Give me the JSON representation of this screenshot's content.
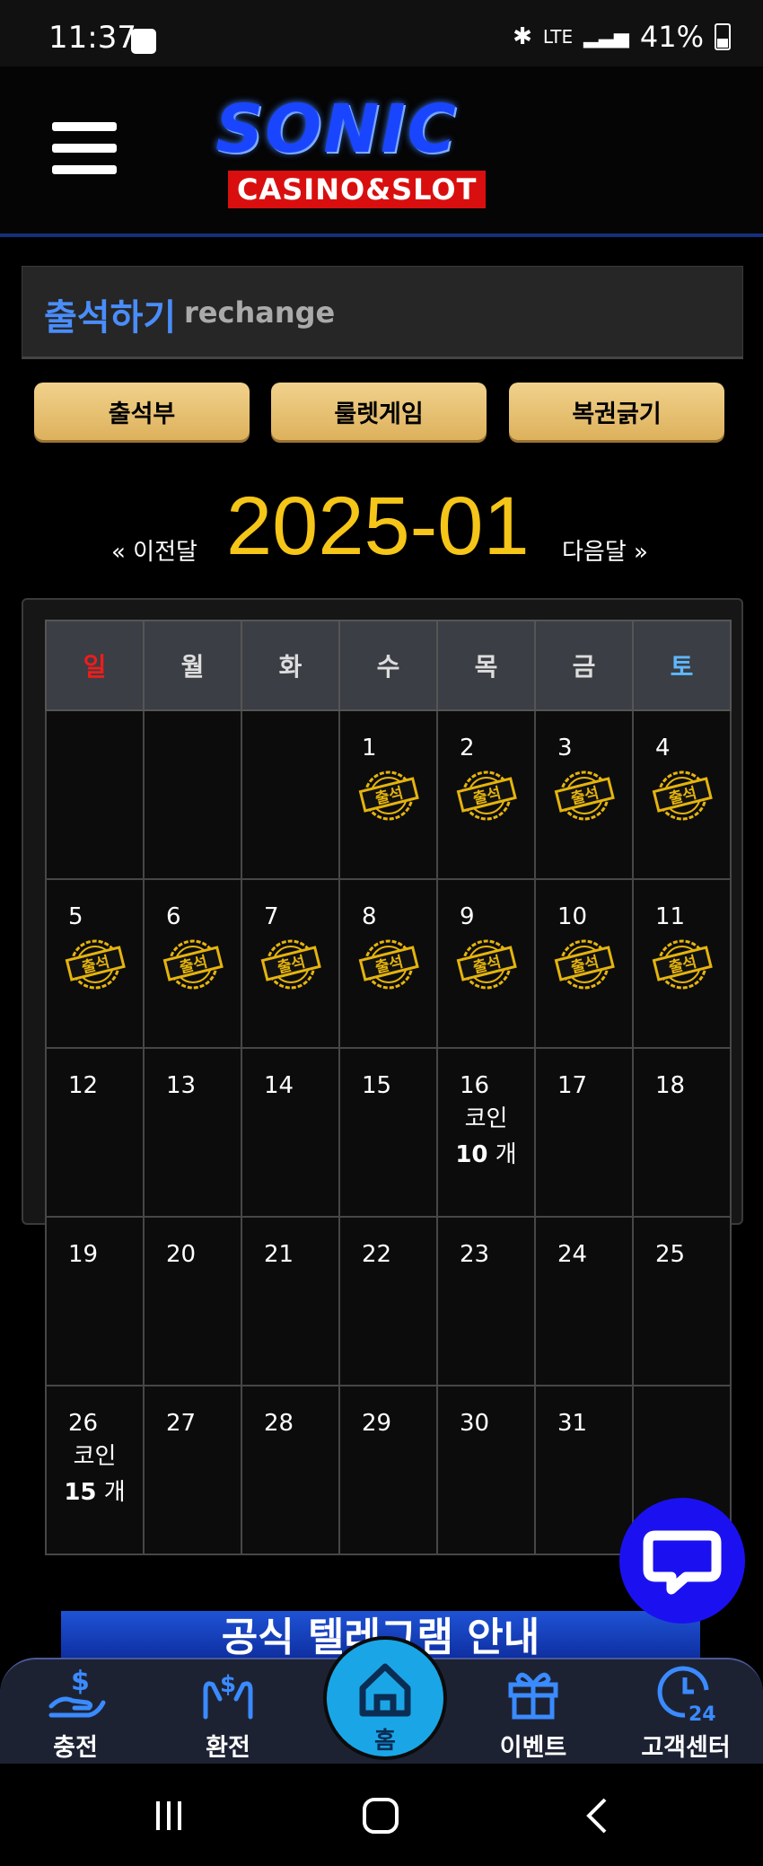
{
  "status_bar": {
    "time": "11:37",
    "network": "LTE",
    "battery": "41%"
  },
  "header": {
    "logo_main": "SONIC",
    "logo_sub": "CASINO&SLOT"
  },
  "title": {
    "korean": "출석하기",
    "english": "rechange"
  },
  "tabs": [
    {
      "label": "출석부"
    },
    {
      "label": "룰렛게임"
    },
    {
      "label": "복권긁기"
    }
  ],
  "month_nav": {
    "prev_label": "« 이전달",
    "current": "2025-01",
    "next_label": "다음달 »"
  },
  "calendar": {
    "weekdays": [
      "일",
      "월",
      "화",
      "수",
      "목",
      "금",
      "토"
    ],
    "stamp_label": "출석",
    "coin_label": "코인",
    "coin_unit": "개",
    "weeks": [
      [
        {
          "day": ""
        },
        {
          "day": ""
        },
        {
          "day": ""
        },
        {
          "day": "1",
          "stamp": true
        },
        {
          "day": "2",
          "stamp": true
        },
        {
          "day": "3",
          "stamp": true
        },
        {
          "day": "4",
          "stamp": true
        }
      ],
      [
        {
          "day": "5",
          "stamp": true
        },
        {
          "day": "6",
          "stamp": true
        },
        {
          "day": "7",
          "stamp": true
        },
        {
          "day": "8",
          "stamp": true
        },
        {
          "day": "9",
          "stamp": true
        },
        {
          "day": "10",
          "stamp": true
        },
        {
          "day": "11",
          "stamp": true
        }
      ],
      [
        {
          "day": "12"
        },
        {
          "day": "13"
        },
        {
          "day": "14"
        },
        {
          "day": "15"
        },
        {
          "day": "16",
          "coin": "10"
        },
        {
          "day": "17"
        },
        {
          "day": "18"
        }
      ],
      [
        {
          "day": "19"
        },
        {
          "day": "20"
        },
        {
          "day": "21"
        },
        {
          "day": "22"
        },
        {
          "day": "23"
        },
        {
          "day": "24"
        },
        {
          "day": "25"
        }
      ],
      [
        {
          "day": "26",
          "coin": "15"
        },
        {
          "day": "27"
        },
        {
          "day": "28"
        },
        {
          "day": "29"
        },
        {
          "day": "30"
        },
        {
          "day": "31"
        },
        {
          "day": ""
        }
      ]
    ]
  },
  "banner": {
    "text": "공식 텔레그램 안내"
  },
  "bottom_nav": [
    {
      "label": "충전",
      "icon": "deposit-icon"
    },
    {
      "label": "환전",
      "icon": "exchange-icon"
    },
    {
      "label": "홈",
      "icon": "home-icon"
    },
    {
      "label": "이벤트",
      "icon": "gift-icon"
    },
    {
      "label": "고객센터",
      "icon": "support-24-icon"
    }
  ],
  "colors": {
    "accent_blue": "#4a8dfa",
    "month_gold": "#f5c518",
    "button_gold": "#e8c06e",
    "chat_blue": "#1b11f0",
    "home_blue": "#1aa6e6"
  }
}
